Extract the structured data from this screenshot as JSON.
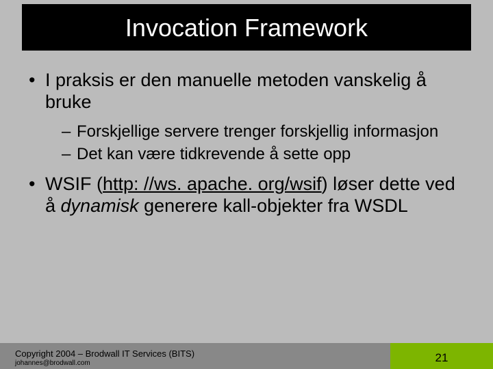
{
  "title": "Invocation Framework",
  "bullets": {
    "b1": "I praksis er den manuelle metoden vanskelig å bruke",
    "b1_sub1": "Forskjellige servere trenger forskjellig informasjon",
    "b1_sub2": "Det kan være tidkrevende å sette opp",
    "b2_pre": "WSIF (",
    "b2_link": "http: //ws. apache. org/wsif",
    "b2_mid": ") løser dette ved å ",
    "b2_ital": "dynamisk",
    "b2_post": " generere kall-objekter fra WSDL"
  },
  "footer": {
    "copyright": "Copyright 2004 – Brodwall IT Services (BITS)",
    "email": "johannes@brodwall.com",
    "page": "21"
  }
}
